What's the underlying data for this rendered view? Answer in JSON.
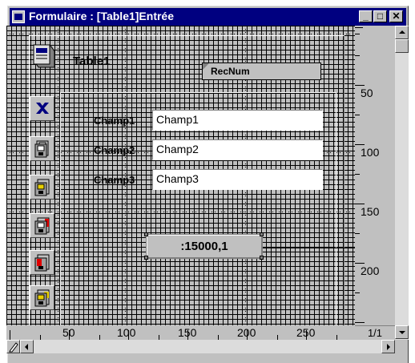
{
  "window": {
    "title": "Formulaire : [Table1]Entrée",
    "minimize_glyph": "_",
    "maximize_glyph": "□",
    "close_glyph": "✕"
  },
  "form": {
    "table_name": "Table1",
    "recnum_label": "RecNum",
    "fields": [
      {
        "label": "Champ1",
        "value": "Champ1"
      },
      {
        "label": "Champ2",
        "value": "Champ2"
      },
      {
        "label": "Champ3",
        "value": "Champ3"
      }
    ],
    "value_display": ":15000,1"
  },
  "toolbar": {
    "icons": [
      "table-icon",
      "delete-icon",
      "save-record-icon",
      "next-record-icon",
      "previous-record-icon",
      "first-record-icon",
      "last-record-icon"
    ]
  },
  "rulers": {
    "vertical_labels": [
      "50",
      "100",
      "150",
      "200"
    ],
    "horizontal_labels": [
      "50",
      "100",
      "150",
      "200",
      "250"
    ]
  },
  "status": {
    "page_indicator": "1/1"
  },
  "colors": {
    "titlebar": "#000080",
    "face": "#c0c0c0",
    "delete_icon": "#000080",
    "icon_yellow": "#e8d000",
    "icon_red": "#e00000"
  }
}
